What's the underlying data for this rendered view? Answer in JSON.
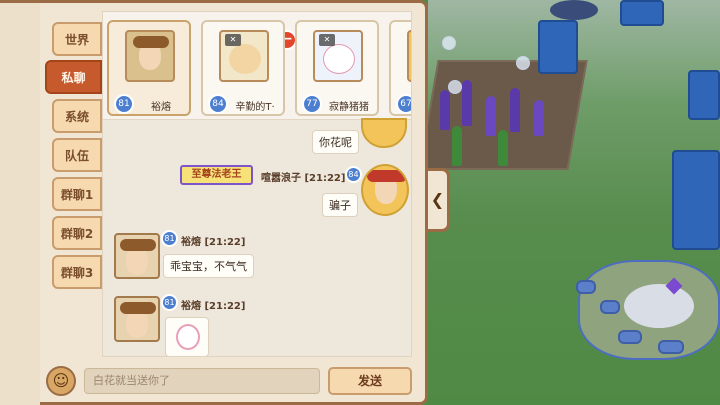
{
  "channels": [
    {
      "label": "世界",
      "active": false
    },
    {
      "label": "私聊",
      "active": true
    },
    {
      "label": "系统",
      "active": false
    },
    {
      "label": "队伍",
      "active": false
    },
    {
      "label": "群聊1",
      "active": false
    },
    {
      "label": "群聊2",
      "active": false
    },
    {
      "label": "群聊3",
      "active": false
    }
  ],
  "contacts": [
    {
      "name": "裕熔",
      "level": "81",
      "muted": false
    },
    {
      "name": "辛勤的T·",
      "level": "84",
      "muted": true
    },
    {
      "name": "寂静猪猪",
      "level": "77",
      "muted": true
    },
    {
      "name": "",
      "level": "67",
      "muted": false
    }
  ],
  "messages": {
    "m1_text": "你花呢",
    "m2_title": "至尊法老王",
    "m2_name": "喧嚣浪子",
    "m2_time": "[21:22]",
    "m2_level": "84",
    "m2_text": "骗子",
    "m3_level": "81",
    "m3_name": "裕熔",
    "m3_time": "[21:22]",
    "m3_text": "乖宝宝，不气气",
    "m4_level": "81",
    "m4_name": "裕熔",
    "m4_time": "[21:22]"
  },
  "input": {
    "value": "白花就当送你了",
    "send_label": "发送",
    "emoji_icon": "☺",
    "collapse_icon": "❮"
  },
  "colors": {
    "active_tab": "#c75a2d",
    "panel_border": "#9a6b44",
    "level_badge": "#4d7fd0",
    "remove": "#e2462c"
  }
}
